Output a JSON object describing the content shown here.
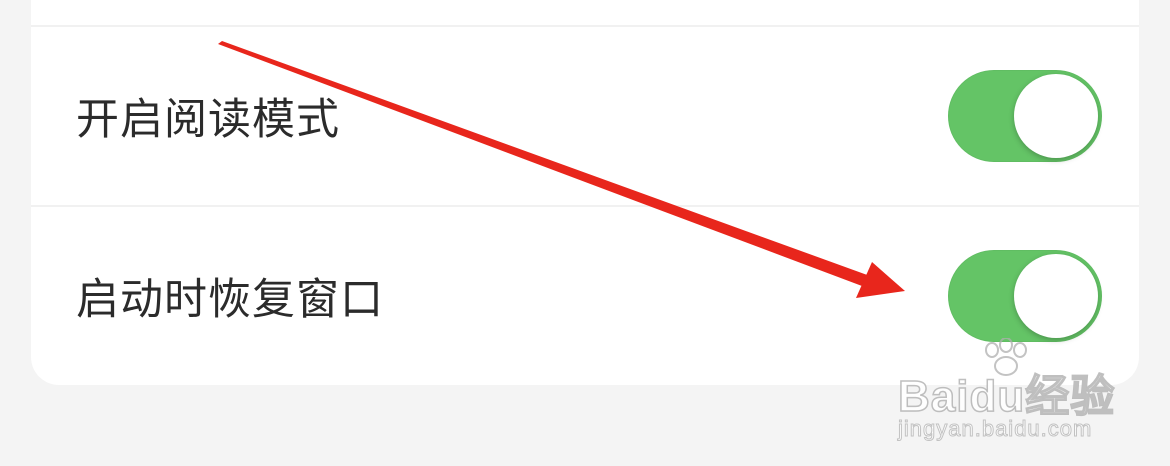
{
  "settings": {
    "items": [
      {
        "label": "开启阅读模式",
        "toggle_on": true
      },
      {
        "label": "启动时恢复窗口",
        "toggle_on": true
      }
    ]
  },
  "colors": {
    "toggle_on": "#64c466",
    "annotation_arrow": "#e8261c",
    "background": "#f4f4f4",
    "card": "#ffffff"
  },
  "watermark": {
    "logo_text": "Baidu经验",
    "url": "jingyan.baidu.com"
  },
  "icons": {
    "annotation": "red-arrow-icon",
    "watermark": "baidu-paw-icon"
  }
}
